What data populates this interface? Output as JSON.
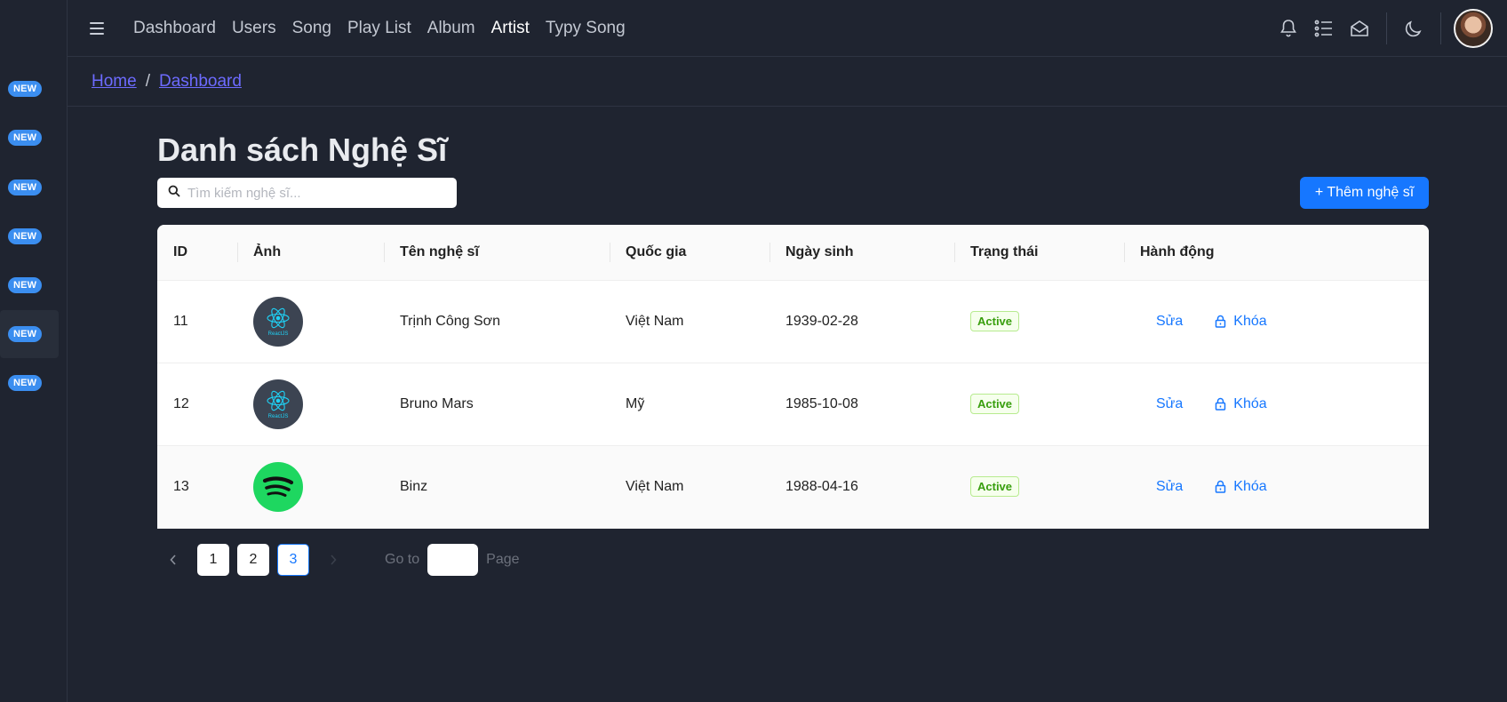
{
  "sidebar": {
    "badges": [
      "NEW",
      "NEW",
      "NEW",
      "NEW",
      "NEW",
      "NEW",
      "NEW"
    ]
  },
  "topnav": {
    "items": [
      "Dashboard",
      "Users",
      "Song",
      "Play List",
      "Album",
      "Artist",
      "Typy Song"
    ],
    "active": "Artist"
  },
  "breadcrumb": {
    "home": "Home",
    "separator": "/",
    "current": "Dashboard"
  },
  "main": {
    "title": "Danh sách Nghệ Sĩ",
    "search_placeholder": "Tìm kiếm nghệ sĩ...",
    "add_button": "+ Thêm nghệ sĩ"
  },
  "table": {
    "columns": [
      "ID",
      "Ảnh",
      "Tên nghệ sĩ",
      "Quốc gia",
      "Ngày sinh",
      "Trạng thái",
      "Hành động"
    ],
    "rows": [
      {
        "id": "11",
        "image": "react-logo",
        "name": "Trịnh Công Sơn",
        "country": "Việt Nam",
        "birthday": "1939-02-28",
        "status": "Active",
        "edit": "Sửa",
        "lock": "Khóa"
      },
      {
        "id": "12",
        "image": "react-logo",
        "name": "Bruno Mars",
        "country": "Mỹ",
        "birthday": "1985-10-08",
        "status": "Active",
        "edit": "Sửa",
        "lock": "Khóa"
      },
      {
        "id": "13",
        "image": "spotify-logo",
        "name": "Binz",
        "country": "Việt Nam",
        "birthday": "1988-04-16",
        "status": "Active",
        "edit": "Sửa",
        "lock": "Khóa"
      }
    ]
  },
  "pagination": {
    "pages": [
      "1",
      "2",
      "3"
    ],
    "current": "3",
    "goto_label": "Go to",
    "page_label": "Page"
  },
  "colors": {
    "background": "#1f2430",
    "accent": "#1677ff",
    "link": "#6d6bff",
    "badge": "#3b8ef0",
    "status_green": "#389e0d"
  }
}
